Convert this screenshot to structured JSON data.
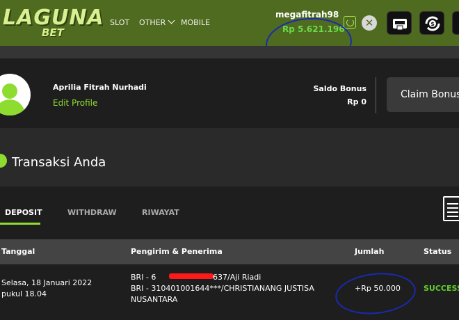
{
  "header": {
    "logo_main": "LAGUNA",
    "logo_sub": "BET",
    "nav": {
      "slot": "SLOT",
      "other": "OTHER",
      "mobile": "MOBILE"
    },
    "username": "megafitrah98",
    "balance": "Rp 5.621.196",
    "close_symbol": "✕"
  },
  "profile": {
    "name": "Aprilia Fitrah Nurhadi",
    "edit_label": "Edit Profile",
    "saldo_bonus_label": "Saldo Bonus",
    "saldo_bonus_value": "Rp 0",
    "claim_label": "Claim Bonus"
  },
  "transactions": {
    "title": "Transaksi Anda",
    "tabs": {
      "deposit": "DEPOSIT",
      "withdraw": "WITHDRAW",
      "riwayat": "RIWAYAT"
    },
    "columns": {
      "date": "Tanggal",
      "sender": "Pengirim & Penerima",
      "amount": "Jumlah",
      "status": "Status"
    },
    "rows": [
      {
        "date_line1": "Selasa, 18 Januari 2022",
        "date_line2": "pukul 18.04",
        "sender_prefix": "BRI - 6",
        "sender_suffix": "637/Aji Riadi",
        "receiver_line1": "BRI - 310401001644***/CHRISTIANANG JUSTISA",
        "receiver_line2": "NUSANTARA",
        "amount": "+Rp 50.000",
        "status": "SUCCESS"
      }
    ]
  },
  "colors": {
    "accent": "#8fdc30",
    "header_bg": "#4f6b1f",
    "balance": "#6dd94a",
    "annotation": "#1a2ab0",
    "redaction": "#ff1a1a"
  }
}
